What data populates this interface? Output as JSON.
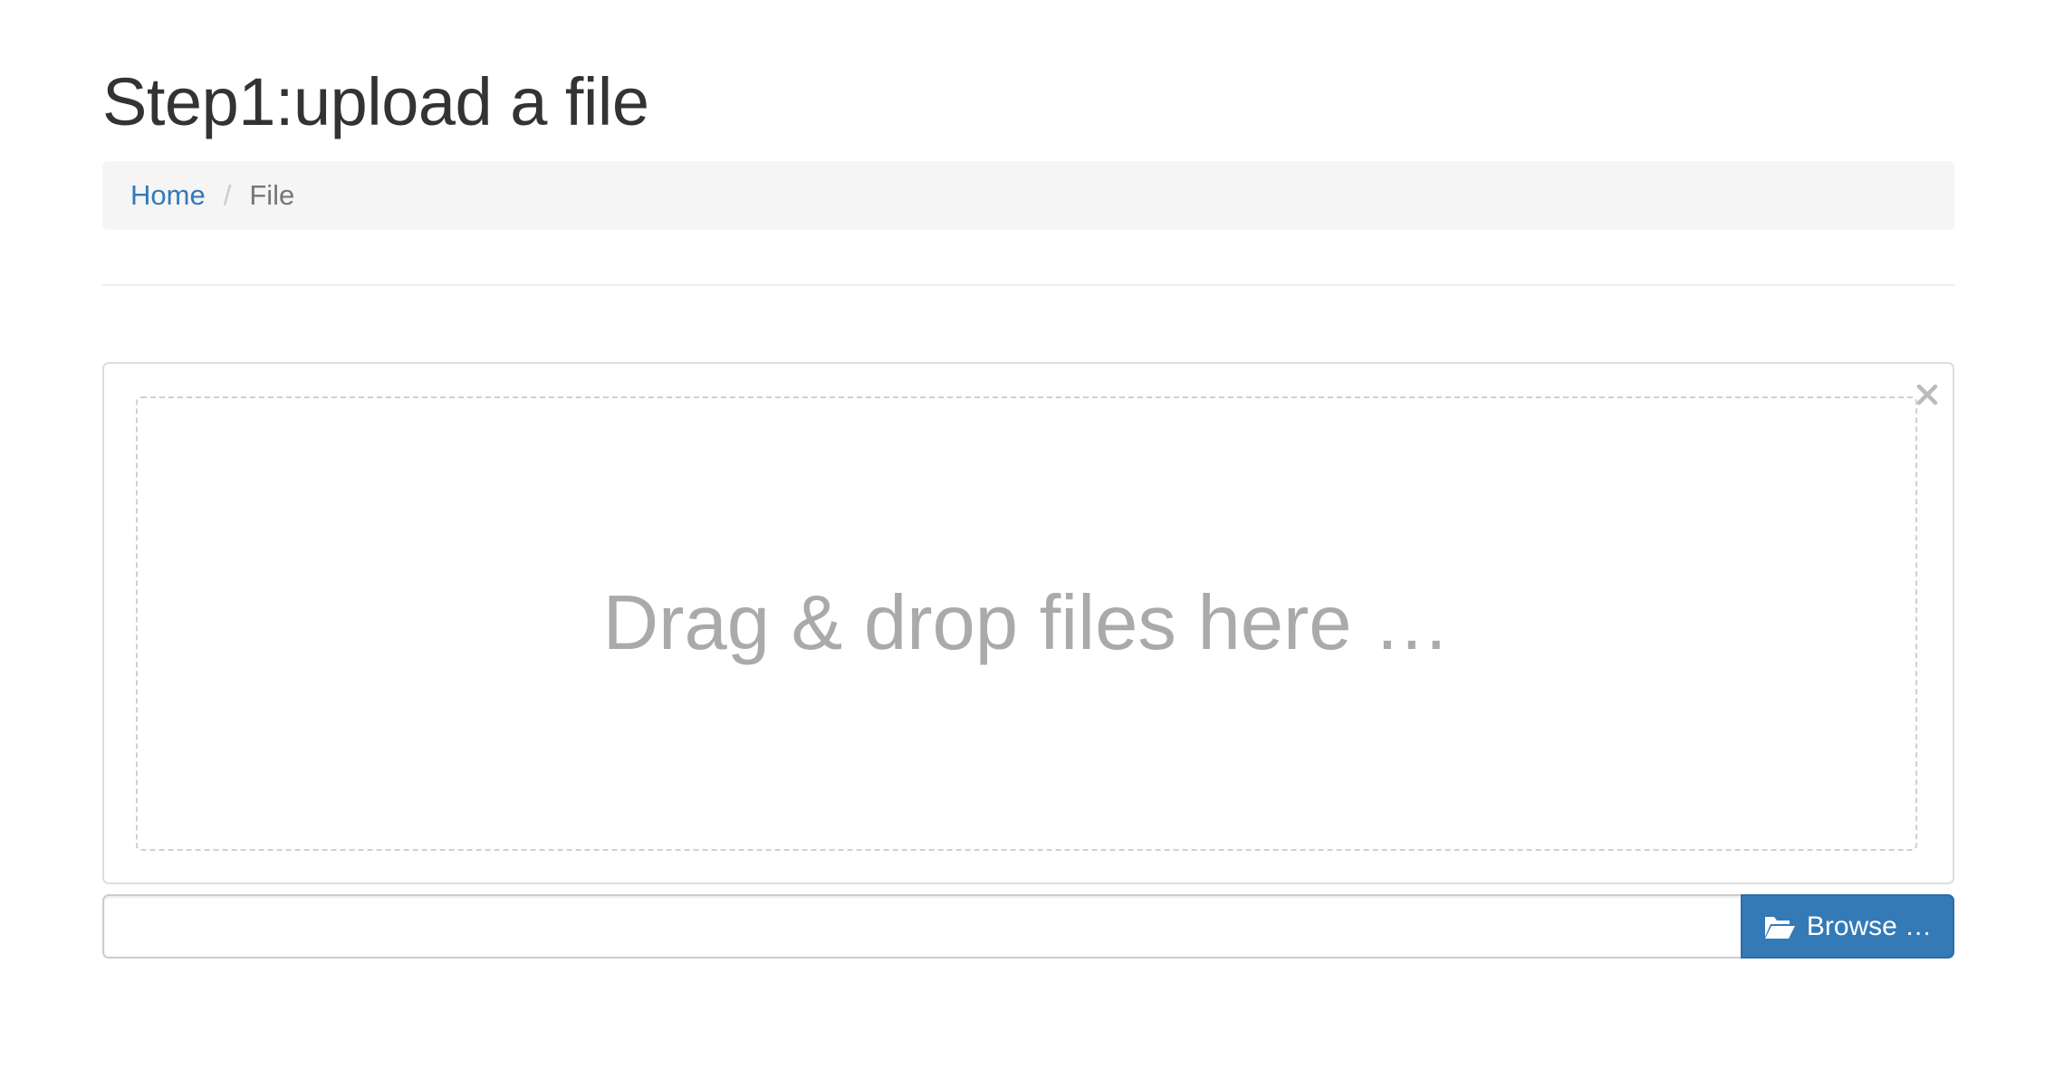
{
  "page": {
    "title": "Step1:upload a file"
  },
  "breadcrumb": {
    "items": [
      {
        "label": "Home"
      },
      {
        "label": "File"
      }
    ],
    "separator": "/"
  },
  "upload": {
    "drop_zone_text": "Drag & drop files here …",
    "close_icon": "close-icon",
    "caption_value": "",
    "browse_label": "Browse …",
    "browse_icon": "folder-open-icon"
  },
  "colors": {
    "link": "#337ab7",
    "primary_button": "#337ab7",
    "breadcrumb_bg": "#f5f5f5",
    "drop_text": "#aaaaaa"
  }
}
